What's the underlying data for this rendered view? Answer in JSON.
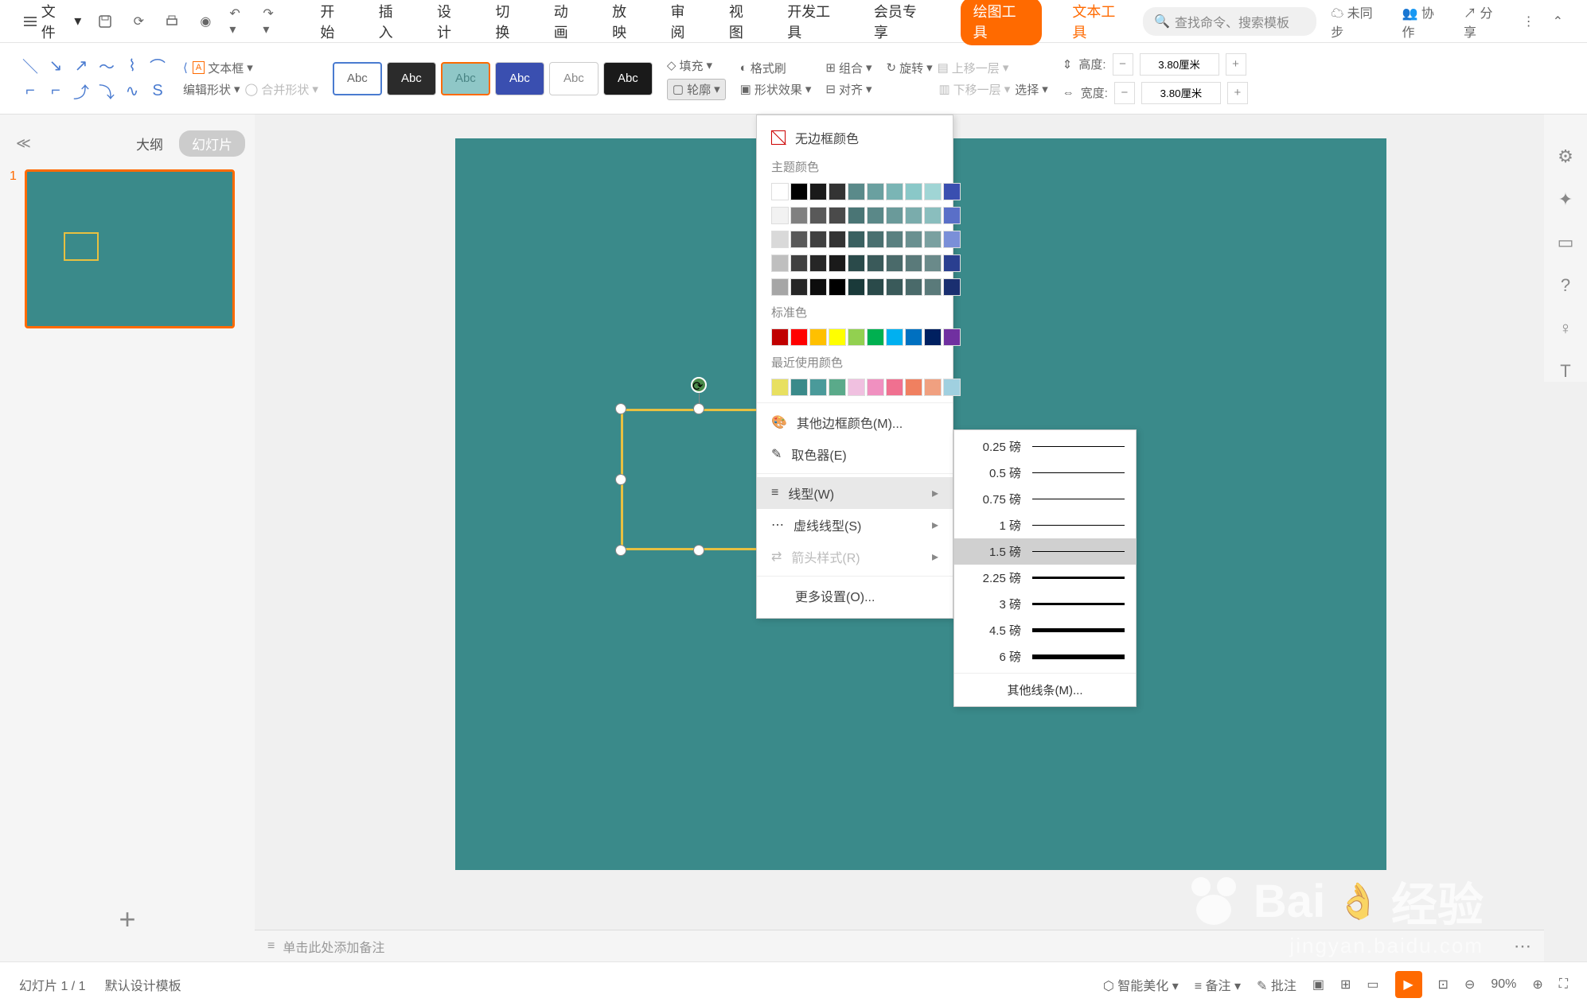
{
  "titlebar": {
    "file_label": "文件",
    "tabs": [
      "开始",
      "插入",
      "设计",
      "切换",
      "动画",
      "放映",
      "审阅",
      "视图",
      "开发工具",
      "会员专享"
    ],
    "tool_tab_drawing": "绘图工具",
    "tool_tab_text": "文本工具",
    "search_placeholder": "查找命令、搜索模板",
    "sync_label": "未同步",
    "collab_label": "协作",
    "share_label": "分享"
  },
  "ribbon": {
    "edit_shape": "编辑形状",
    "merge_shape": "合并形状",
    "textbox": "文本框",
    "style_label": "Abc",
    "fill": "填充",
    "outline": "轮廓",
    "format_painter": "格式刷",
    "shape_effects": "形状效果",
    "group": "组合",
    "rotate": "旋转",
    "align": "对齐",
    "bring_forward": "上移一层",
    "send_backward": "下移一层",
    "select": "选择",
    "height_label": "高度:",
    "width_label": "宽度:",
    "height_value": "3.80厘米",
    "width_value": "3.80厘米"
  },
  "left_panel": {
    "outline_tab": "大纲",
    "slides_tab": "幻灯片",
    "slide_num": "1"
  },
  "outline_menu": {
    "no_border": "无边框颜色",
    "theme_colors": "主题颜色",
    "standard_colors": "标准色",
    "recent_colors": "最近使用颜色",
    "more_colors": "其他边框颜色(M)...",
    "eyedropper": "取色器(E)",
    "weight": "线型(W)",
    "dashes": "虚线线型(S)",
    "arrows": "箭头样式(R)",
    "more_settings": "更多设置(O)..."
  },
  "weight_menu": {
    "items": [
      "0.25 磅",
      "0.5 磅",
      "0.75 磅",
      "1 磅",
      "1.5 磅",
      "2.25 磅",
      "3 磅",
      "4.5 磅",
      "6 磅"
    ],
    "more": "其他线条(M)..."
  },
  "notes": {
    "placeholder": "单击此处添加备注"
  },
  "status": {
    "slide_info": "幻灯片 1 / 1",
    "template": "默认设计模板",
    "beautify": "智能美化",
    "notes_btn": "备注",
    "comments_btn": "批注",
    "zoom": "90%"
  },
  "watermark_text": "Bai",
  "watermark_text2": "经验",
  "watermark_sub": "jingyan.baidu.com",
  "theme_colors": [
    [
      "#ffffff",
      "#000000",
      "#1a1a1a",
      "#333333",
      "#5a8a8a",
      "#6aa0a0",
      "#7ab5b5",
      "#8ac8c8",
      "#a0d5d5",
      "#3a4fb0"
    ],
    [
      "#f2f2f2",
      "#808080",
      "#595959",
      "#4a4a4a",
      "#4a7575",
      "#5a8888",
      "#6a9a9a",
      "#7aacac",
      "#8abebe",
      "#5a6fc8"
    ],
    [
      "#d9d9d9",
      "#595959",
      "#404040",
      "#333333",
      "#3a6060",
      "#4a7070",
      "#5a8080",
      "#6a9090",
      "#7aa0a0",
      "#7a8fd8"
    ],
    [
      "#bfbfbf",
      "#404040",
      "#262626",
      "#1a1a1a",
      "#2a4a4a",
      "#3a5a5a",
      "#4a6a6a",
      "#5a7a7a",
      "#6a8a8a",
      "#2a3f90"
    ],
    [
      "#a6a6a6",
      "#262626",
      "#0d0d0d",
      "#000000",
      "#1a3a3a",
      "#2a4a4a",
      "#3a5a5a",
      "#4a6a6a",
      "#5a7a7a",
      "#1a2f70"
    ]
  ],
  "standard_colors": [
    "#c00000",
    "#ff0000",
    "#ffc000",
    "#ffff00",
    "#92d050",
    "#00b050",
    "#00b0f0",
    "#0070c0",
    "#002060",
    "#7030a0"
  ],
  "recent_colors": [
    "#e8e060",
    "#3a8a8a",
    "#4a9a9a",
    "#5aaa8a",
    "#f0c0e0",
    "#f090c0",
    "#f07090",
    "#f08060",
    "#f0a080",
    "#a0d0e0"
  ]
}
